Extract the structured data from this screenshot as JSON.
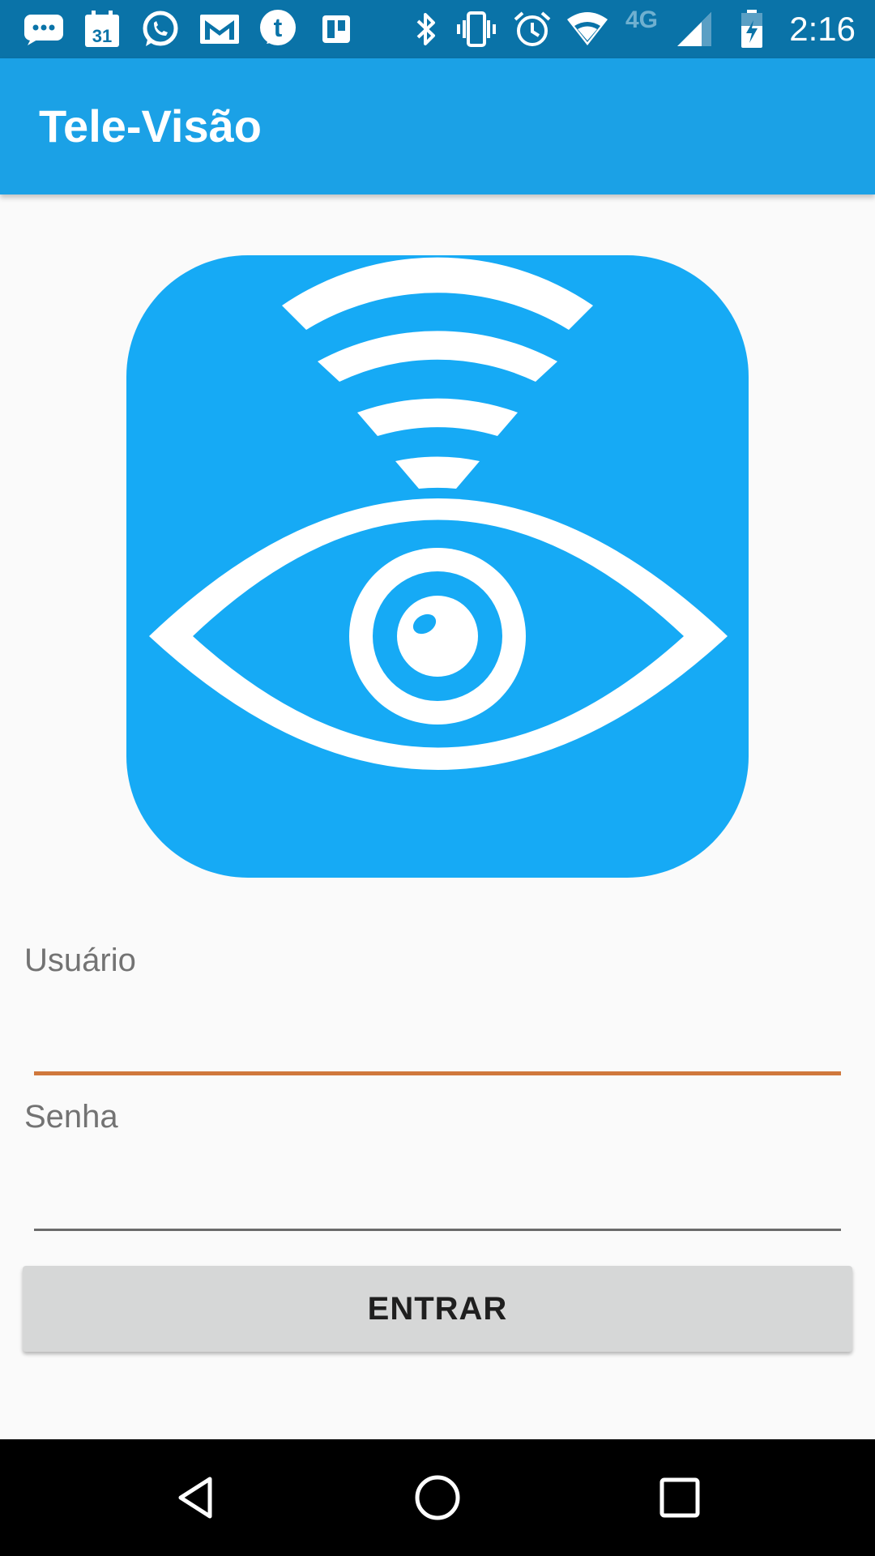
{
  "status_bar": {
    "time": "2:16",
    "network_label": "4G",
    "icons": [
      "messages-icon",
      "calendar-icon",
      "whatsapp-icon",
      "gmail-icon",
      "tumblr-icon",
      "trello-icon",
      "bluetooth-icon",
      "vibrate-icon",
      "alarm-icon",
      "wifi-icon",
      "signal-icon",
      "battery-charging-icon"
    ],
    "calendar_day": "31",
    "tumblr_letter": "t"
  },
  "app_bar": {
    "title": "Tele-Visão"
  },
  "logo": {
    "icon": "eye-wifi-logo-icon",
    "background_color": "#16aaf5",
    "foreground_color": "#ffffff"
  },
  "form": {
    "username": {
      "label": "Usuário",
      "value": ""
    },
    "password": {
      "label": "Senha",
      "value": ""
    },
    "submit_label": "ENTRAR"
  },
  "nav_bar": {
    "icons": [
      "back-icon",
      "home-icon",
      "recents-icon"
    ]
  },
  "colors": {
    "status_bar": "#0a73a8",
    "app_bar": "#1ba1e6",
    "accent": "#d0783c",
    "button": "#d6d7d7"
  }
}
